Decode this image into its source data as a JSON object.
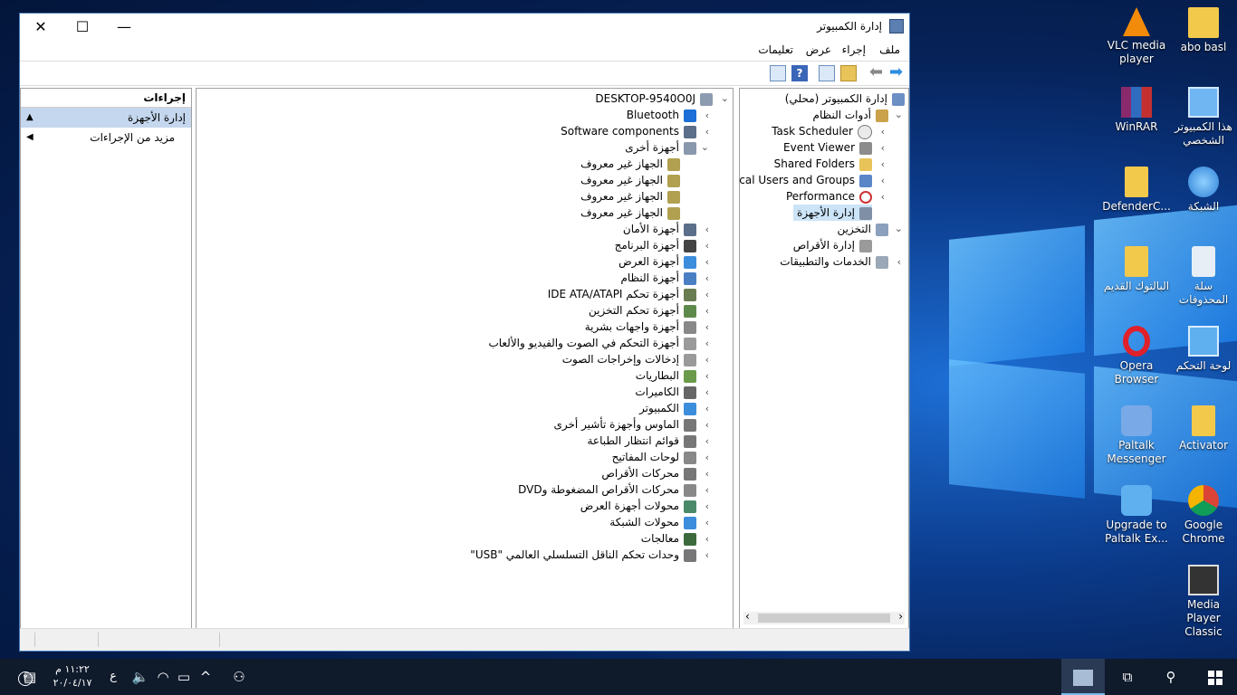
{
  "window": {
    "title": "إدارة الكمبيوتر",
    "close": "✕",
    "maximize": "☐",
    "minimize": "—"
  },
  "menu": [
    "ملف",
    "إجراء",
    "عرض",
    "تعليمات"
  ],
  "tree": {
    "root": "إدارة الكمبيوتر (محلي)",
    "system_tools": "أدوات النظام",
    "task_scheduler": "Task Scheduler",
    "event_viewer": "Event Viewer",
    "shared_folders": "Shared Folders",
    "local_users": "Local Users and Groups",
    "performance": "Performance",
    "device_manager": "إدارة الأجهزة",
    "storage": "التخزين",
    "disk_management": "إدارة الأقراص",
    "services": "الخدمات والتطبيقات"
  },
  "devices": {
    "computer_name": "DESKTOP-9540O0J",
    "items": [
      "Bluetooth",
      "Software components",
      "أجهزة أخرى",
      "الجهاز غير معروف",
      "الجهاز غير معروف",
      "الجهاز غير معروف",
      "الجهاز غير معروف",
      "أجهزة الأمان",
      "أجهزة البرنامج",
      "أجهزة العرض",
      "أجهزة النظام",
      "أجهزة تحكم IDE ATA/ATAPI",
      "أجهزة تحكم التخزين",
      "أجهزة واجهات بشرية",
      "أجهزة التحكم في الصوت والفيديو والألعاب",
      "إدخالات وإخراجات الصوت",
      "البطاريات",
      "الكاميرات",
      "الكمبيوتر",
      "الماوس وأجهزة تأشير أخرى",
      "قوائم انتظار الطباعة",
      "لوحات المفاتيح",
      "محركات الأقراص",
      "محركات الأقراص المضغوطة وDVD",
      "محولات أجهزة العرض",
      "محولات الشبكة",
      "معالجات",
      "وحدات تحكم الناقل التسلسلي العالمي \"USB\""
    ]
  },
  "actions": {
    "header": "إجراءات",
    "selected": "إدارة الأجهزة",
    "more": "مزيد من الإجراءات"
  },
  "desktop": [
    "abo basl",
    "VLC media player",
    "هذا الكمبيوتر الشخصي",
    "WinRAR",
    "الشبكة",
    "DefenderC...",
    "سلة المحذوفات",
    "البالتوك القديم",
    "لوحة التحكم",
    "Opera Browser",
    "Activator",
    "Paltalk Messenger",
    "Google Chrome",
    "Upgrade to Paltalk Ex...",
    "Media Player Classic"
  ],
  "taskbar": {
    "time": "١١:٢٢ م",
    "date": "٢٠/٠٤/١٧",
    "lang": "ع",
    "notif_count": "٢"
  },
  "colors": {
    "selection": "#c5d7ee",
    "taskbar": "#0f1a2b",
    "accent": "#0078d7"
  }
}
